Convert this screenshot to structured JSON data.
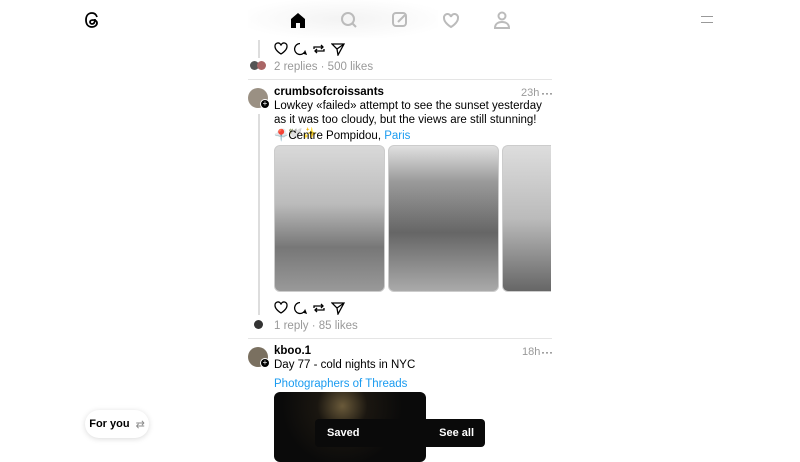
{
  "nav": {
    "items": [
      "home",
      "search",
      "create",
      "activity",
      "profile"
    ]
  },
  "post0": {
    "meta": "2 replies · 500 likes"
  },
  "post1": {
    "username": "crumbsofcroissants",
    "time": "23h",
    "text": "Lowkey «failed» attempt to see the sunset yesterday as it was too cloudy, but the views are still stunning! ☁️🕊️✨",
    "location_pin": "📍",
    "location": "Centre Pompidou, ",
    "location_link": "Paris",
    "meta": "1 reply · 85 likes"
  },
  "post2": {
    "username": "kboo.1",
    "time": "18h",
    "text": "Day 77 - cold nights in NYC",
    "tag": "Photographers of Threads"
  },
  "feed_switch": {
    "label": "For you",
    "icon": "⇄"
  },
  "toast": {
    "label": "Saved",
    "action": "See all"
  },
  "more": "···"
}
